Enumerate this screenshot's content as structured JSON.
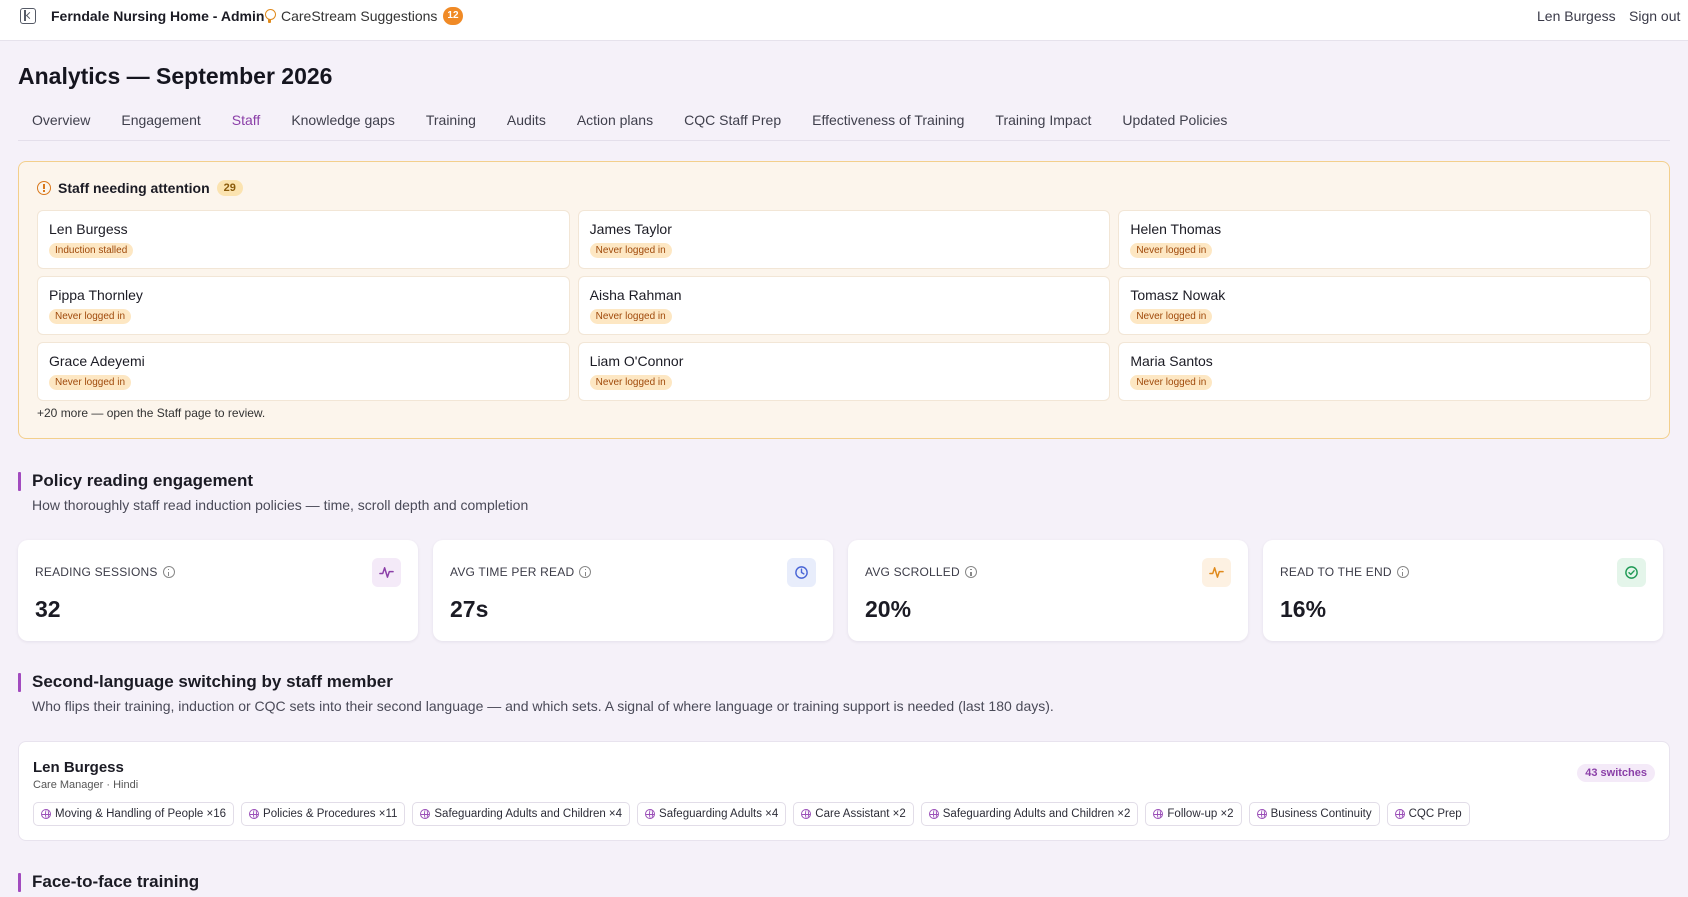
{
  "topbar": {
    "app_name": "Ferndale Nursing Home - Admin",
    "suggestions_label": "CareStream Suggestions",
    "suggestions_count": "12",
    "user_name": "Len Burgess",
    "signout_label": "Sign out"
  },
  "page": {
    "title": "Analytics — September 2026"
  },
  "tabs": [
    {
      "label": "Overview"
    },
    {
      "label": "Engagement"
    },
    {
      "label": "Staff",
      "active": true
    },
    {
      "label": "Knowledge gaps"
    },
    {
      "label": "Training"
    },
    {
      "label": "Audits"
    },
    {
      "label": "Action plans"
    },
    {
      "label": "CQC Staff Prep"
    },
    {
      "label": "Effectiveness of Training"
    },
    {
      "label": "Training Impact"
    },
    {
      "label": "Updated Policies"
    }
  ],
  "attention": {
    "title": "Staff needing attention",
    "count": "29",
    "staff": [
      {
        "name": "Len Burgess",
        "status": "Induction stalled"
      },
      {
        "name": "James Taylor",
        "status": "Never logged in"
      },
      {
        "name": "Helen Thomas",
        "status": "Never logged in"
      },
      {
        "name": "Pippa Thornley",
        "status": "Never logged in"
      },
      {
        "name": "Aisha Rahman",
        "status": "Never logged in"
      },
      {
        "name": "Tomasz Nowak",
        "status": "Never logged in"
      },
      {
        "name": "Grace Adeyemi",
        "status": "Never logged in"
      },
      {
        "name": "Liam O'Connor",
        "status": "Never logged in"
      },
      {
        "name": "Maria Santos",
        "status": "Never logged in"
      }
    ],
    "more_text": "+20 more — open the Staff page to review."
  },
  "engagement": {
    "title": "Policy reading engagement",
    "subtitle": "How thoroughly staff read induction policies — time, scroll depth and completion",
    "stats": [
      {
        "label": "READING SESSIONS",
        "value": "32",
        "icon": "activity-icon",
        "color": "#8b3fa8"
      },
      {
        "label": "AVG TIME PER READ",
        "value": "27s",
        "icon": "clock-icon",
        "color": "#4a66d6"
      },
      {
        "label": "AVG SCROLLED",
        "value": "20%",
        "icon": "pulse-icon",
        "color": "#e08a1c"
      },
      {
        "label": "READ TO THE END",
        "value": "16%",
        "icon": "check-circle-icon",
        "color": "#1f9a55"
      }
    ]
  },
  "language": {
    "title": "Second-language switching by staff member",
    "subtitle": "Who flips their training, induction or CQC sets into their second language — and which sets. A signal of where language or training support is needed (last 180 days).",
    "member": {
      "name": "Len Burgess",
      "role": "Care Manager · Hindi",
      "switches": "43 switches",
      "chips": [
        "Moving & Handling of People ×16",
        "Policies & Procedures ×11",
        "Safeguarding Adults and Children ×4",
        "Safeguarding Adults ×4",
        "Care Assistant ×2",
        "Safeguarding Adults and Children ×2",
        "Follow-up ×2",
        "Business Continuity",
        "CQC Prep"
      ]
    }
  },
  "face_to_face": {
    "title": "Face-to-face training"
  }
}
